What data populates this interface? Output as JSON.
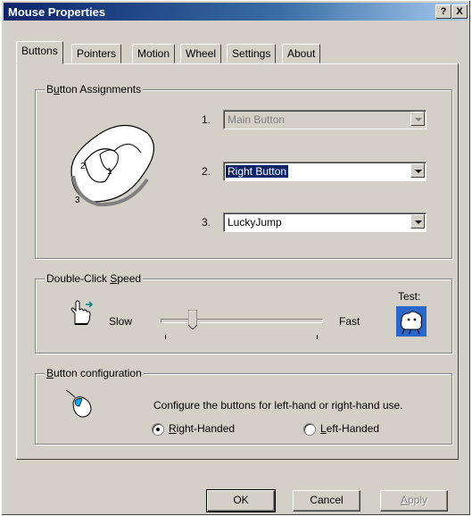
{
  "window": {
    "title": "Mouse Properties",
    "help_button": "?",
    "close_button": "X"
  },
  "tabs": [
    {
      "label": "Buttons",
      "active": true
    },
    {
      "label": "Pointers"
    },
    {
      "label": "Motion"
    },
    {
      "label": "Wheel"
    },
    {
      "label": "Settings"
    },
    {
      "label": "About"
    }
  ],
  "button_assignments": {
    "legend_prefix": "B",
    "legend_u": "u",
    "legend_rest": "tton Assignments",
    "mouse_labels": [
      "2",
      "1",
      "3"
    ],
    "rows": [
      {
        "number": "1.",
        "value": "Main Button",
        "disabled": true
      },
      {
        "number": "2.",
        "value": "Right Button",
        "selected": true
      },
      {
        "number": "3.",
        "value": "LuckyJump"
      }
    ]
  },
  "double_click": {
    "legend_prefix": "Double-Click ",
    "legend_u": "S",
    "legend_rest": "peed",
    "slow_label": "Slow",
    "fast_label": "Fast",
    "test_label": "Test:",
    "speed_fraction": 0.2
  },
  "button_config": {
    "legend_u": "B",
    "legend_rest": "utton configuration",
    "description": "Configure the buttons for left-hand or right-hand use.",
    "right_u": "R",
    "right_rest": "ight-Handed",
    "left_u": "L",
    "left_rest": "eft-Handed",
    "selected": "right"
  },
  "footer": {
    "ok": "OK",
    "cancel": "Cancel",
    "apply_u": "A",
    "apply_rest": "pply"
  },
  "colors": {
    "titlebar_start": "#0a246a",
    "selection": "#0a246a",
    "face": "#d4d0c8"
  }
}
